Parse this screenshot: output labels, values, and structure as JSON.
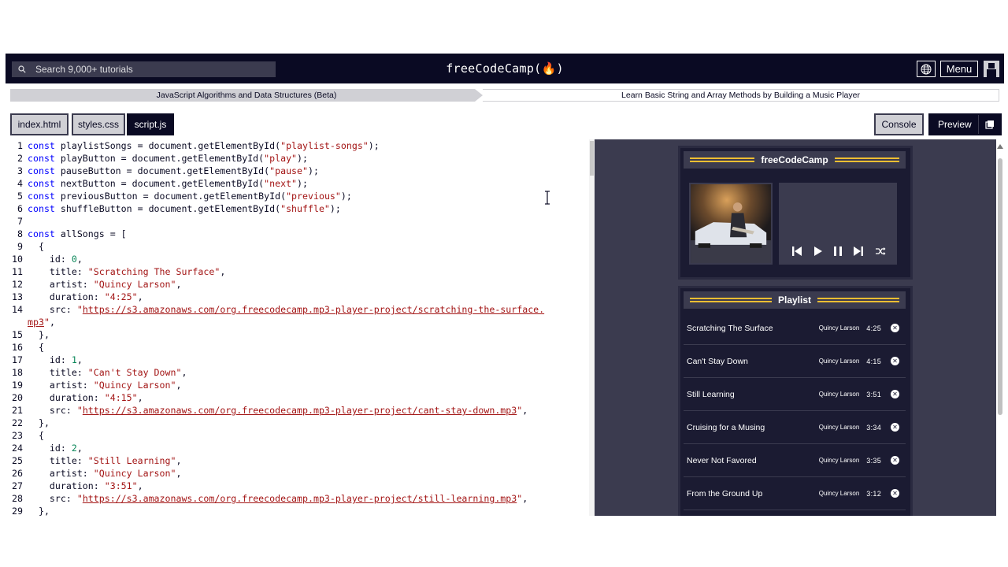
{
  "navbar": {
    "search_placeholder": "Search 9,000+ tutorials",
    "logo": "freeCodeCamp(🔥)",
    "menu_label": "Menu"
  },
  "breadcrumb": {
    "course": "JavaScript Algorithms and Data Structures (Beta)",
    "project": "Learn Basic String and Array Methods by Building a Music Player"
  },
  "tabs": [
    "index.html",
    "styles.css",
    "script.js"
  ],
  "active_tab": "script.js",
  "console_label": "Console",
  "preview_label": "Preview",
  "editor_lines": [
    {
      "n": "1",
      "html": "<span class='kw'>const</span> playlistSongs = document.getElementById(<span class='str'>\"playlist-songs\"</span>);"
    },
    {
      "n": "2",
      "html": "<span class='kw'>const</span> playButton = document.getElementById(<span class='str'>\"play\"</span>);"
    },
    {
      "n": "3",
      "html": "<span class='kw'>const</span> pauseButton = document.getElementById(<span class='str'>\"pause\"</span>);"
    },
    {
      "n": "4",
      "html": "<span class='kw'>const</span> nextButton = document.getElementById(<span class='str'>\"next\"</span>);"
    },
    {
      "n": "5",
      "html": "<span class='kw'>const</span> previousButton = document.getElementById(<span class='str'>\"previous\"</span>);"
    },
    {
      "n": "6",
      "html": "<span class='kw'>const</span> shuffleButton = document.getElementById(<span class='str'>\"shuffle\"</span>);"
    },
    {
      "n": "7",
      "html": ""
    },
    {
      "n": "8",
      "html": "<span class='kw'>const</span> allSongs = ["
    },
    {
      "n": "9",
      "html": "  {"
    },
    {
      "n": "10",
      "html": "    id: <span class='numv'>0</span>,"
    },
    {
      "n": "11",
      "html": "    title: <span class='str'>\"Scratching The Surface\"</span>,"
    },
    {
      "n": "12",
      "html": "    artist: <span class='str'>\"Quincy Larson\"</span>,"
    },
    {
      "n": "13",
      "html": "    duration: <span class='str'>\"4:25\"</span>,"
    },
    {
      "n": "14",
      "html": "    src: <span class='str'>\"</span><span class='url'>https://s3.amazonaws.com/org.freecodecamp.mp3-player-project/scratching-the-surface.</span>"
    },
    {
      "n": "",
      "html": "<span class='url'>mp3</span><span class='str'>\"</span>,"
    },
    {
      "n": "15",
      "html": "  },"
    },
    {
      "n": "16",
      "html": "  {"
    },
    {
      "n": "17",
      "html": "    id: <span class='numv'>1</span>,"
    },
    {
      "n": "18",
      "html": "    title: <span class='str'>\"Can't Stay Down\"</span>,"
    },
    {
      "n": "19",
      "html": "    artist: <span class='str'>\"Quincy Larson\"</span>,"
    },
    {
      "n": "20",
      "html": "    duration: <span class='str'>\"4:15\"</span>,"
    },
    {
      "n": "21",
      "html": "    src: <span class='str'>\"</span><span class='url'>https://s3.amazonaws.com/org.freecodecamp.mp3-player-project/cant-stay-down.mp3</span><span class='str'>\"</span>,"
    },
    {
      "n": "22",
      "html": "  },"
    },
    {
      "n": "23",
      "html": "  {"
    },
    {
      "n": "24",
      "html": "    id: <span class='numv'>2</span>,"
    },
    {
      "n": "25",
      "html": "    title: <span class='str'>\"Still Learning\"</span>,"
    },
    {
      "n": "26",
      "html": "    artist: <span class='str'>\"Quincy Larson\"</span>,"
    },
    {
      "n": "27",
      "html": "    duration: <span class='str'>\"3:51\"</span>,"
    },
    {
      "n": "28",
      "html": "    src: <span class='str'>\"</span><span class='url'>https://s3.amazonaws.com/org.freecodecamp.mp3-player-project/still-learning.mp3</span><span class='str'>\"</span>,"
    },
    {
      "n": "29",
      "html": "  },"
    }
  ],
  "player": {
    "title": "freeCodeCamp"
  },
  "playlist": {
    "title": "Playlist",
    "songs": [
      {
        "title": "Scratching The Surface",
        "artist": "Quincy Larson",
        "duration": "4:25"
      },
      {
        "title": "Can't Stay Down",
        "artist": "Quincy Larson",
        "duration": "4:15"
      },
      {
        "title": "Still Learning",
        "artist": "Quincy Larson",
        "duration": "3:51"
      },
      {
        "title": "Cruising for a Musing",
        "artist": "Quincy Larson",
        "duration": "3:34"
      },
      {
        "title": "Never Not Favored",
        "artist": "Quincy Larson",
        "duration": "3:35"
      },
      {
        "title": "From the Ground Up",
        "artist": "Quincy Larson",
        "duration": "3:12"
      }
    ]
  },
  "colors": {
    "navbar": "#0a0a23",
    "accent_gold": "#f1be32",
    "preview_bg": "#3b3b4f",
    "player_panel": "#1b1b32"
  }
}
